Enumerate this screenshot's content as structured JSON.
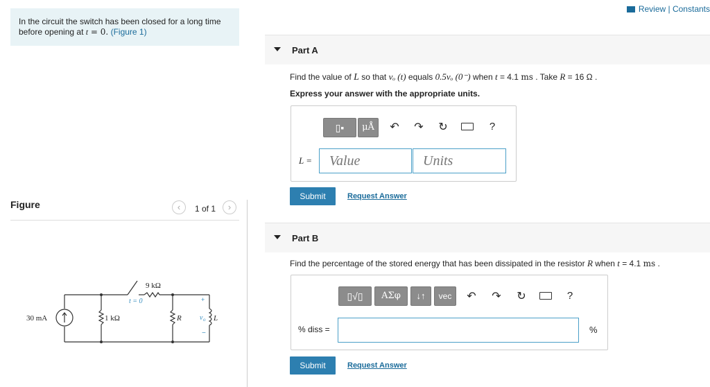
{
  "prompt": {
    "text_before": "In the circuit the switch has been closed for a long time before opening at ",
    "var_t": "t",
    "eq_zero": " = 0.",
    "figure_link": "(Figure 1)"
  },
  "figure": {
    "label": "Figure",
    "pager": "1 of 1",
    "circuit_labels": {
      "source": "30 mA",
      "r1": "1 kΩ",
      "r9": "9 kΩ",
      "switch_time": "t = 0",
      "r": "R",
      "vo": "v",
      "vo_sub": "o",
      "l": "L",
      "plus": "+",
      "minus": "−"
    }
  },
  "header": {
    "review": "Review",
    "separator": " | ",
    "constants": "Constants"
  },
  "part_a": {
    "title": "Part A",
    "q_find": "Find the value of ",
    "q_L": "L",
    "q_so_that": " so that ",
    "q_vo_t": "vₒ (t)",
    "q_equals": " equals ",
    "q_half": "0.5vₒ (0⁻)",
    "q_when": " when ",
    "q_t": "t",
    "q_val": " = 4.1 ",
    "q_ms": "ms",
    "q_take": " . Take ",
    "q_R": "R",
    "q_rval": " = 16 Ω .",
    "instruction": "Express your answer with the appropriate units.",
    "toolbar": {
      "templates": "▯▪",
      "units_btn": "μÅ",
      "undo": "↶",
      "redo": "↷",
      "reset": "↻",
      "help": "?"
    },
    "var_label": "L =",
    "value_placeholder": "Value",
    "units_placeholder": "Units",
    "submit": "Submit",
    "request": "Request Answer"
  },
  "part_b": {
    "title": "Part B",
    "q_text": "Find the percentage of the stored energy that has been dissipated in the resistor ",
    "q_R": "R",
    "q_when": " when ",
    "q_t": "t",
    "q_val": " = 4.1 ",
    "q_ms": "ms",
    "q_end": " .",
    "toolbar": {
      "templates": "▯√▯",
      "greek": "ΑΣφ",
      "arrows": "↓↑",
      "vec": "vec",
      "undo": "↶",
      "redo": "↷",
      "reset": "↻",
      "help": "?"
    },
    "var_label": "% diss =",
    "unit_suffix": "%",
    "submit": "Submit",
    "request": "Request Answer"
  }
}
